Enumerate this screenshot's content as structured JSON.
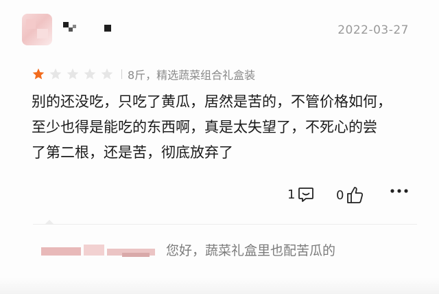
{
  "review": {
    "date": "2022-03-27",
    "rating": {
      "value": 1,
      "max": 5
    },
    "spec": "8斤，精选蔬菜组合礼盒装",
    "text_lines": [
      "别的还没吃，只吃了黄瓜，居然是苦的，不管价格如何，",
      "至少也得是能吃的东西啊，真是太失望了，不死心的尝",
      "了第二根，还是苦，彻底放弃了"
    ],
    "comment_count": "1",
    "like_count": "0"
  },
  "reply": {
    "text": "您好，蔬菜礼盒里也配苦瓜的"
  },
  "colors": {
    "star_active": "#f26b1d",
    "star_inactive": "#e6e6e6",
    "date": "#9a9a9a",
    "reply_text": "#7b7b7b"
  },
  "icons": [
    "comment-icon",
    "thumbs-up-icon",
    "more-icon",
    "star-icon"
  ]
}
